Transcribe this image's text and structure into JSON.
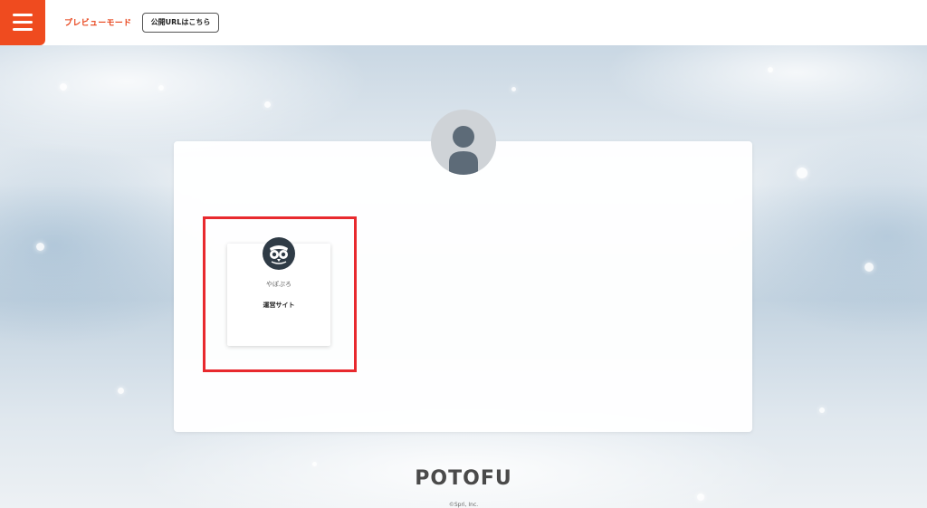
{
  "header": {
    "menu_icon": "hamburger-icon",
    "brand_color": "#ef4b1f",
    "mode_label": "プレビューモード",
    "public_url_button": "公開URLはこちら"
  },
  "profile": {
    "avatar_icon": "user-silhouette-icon"
  },
  "cards": [
    {
      "icon": "owl-icon",
      "name": "やぽぷろ",
      "description": "運営サイト"
    }
  ],
  "highlight_color": "#e8292e",
  "footer": {
    "logo": "POTOFU",
    "copyright": "©Spri, Inc."
  }
}
